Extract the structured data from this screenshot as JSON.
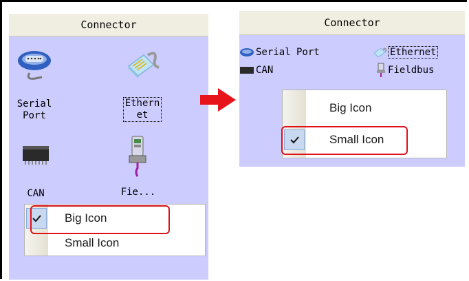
{
  "left_panel": {
    "header": "Connector",
    "items": [
      {
        "label_line1": "Serial",
        "label_line2": "Port",
        "icon": "serial-port-icon"
      },
      {
        "label_line1": "Ethern",
        "label_line2": "et",
        "icon": "ethernet-icon"
      },
      {
        "label_line1": "CAN",
        "icon": "can-icon"
      },
      {
        "label_line1": "Fie...",
        "icon": "fieldbus-icon"
      }
    ],
    "menu": {
      "item1": "Big Icon",
      "item2": "Small Icon",
      "checked": "item1"
    }
  },
  "right_panel": {
    "header": "Connector",
    "items": [
      {
        "label": "Serial Port",
        "icon": "serial-port-icon"
      },
      {
        "label": "Ethernet",
        "icon": "ethernet-icon"
      },
      {
        "label": "CAN",
        "icon": "can-icon"
      },
      {
        "label": "Fieldbus",
        "icon": "fieldbus-icon"
      }
    ],
    "menu": {
      "item1": "Big Icon",
      "item2": "Small Icon",
      "checked": "item2"
    }
  },
  "colors": {
    "panel_bg": "#ccccff",
    "header_bg": "#f0eee0",
    "highlight": "#e0101a",
    "arrow": "#e8141c"
  }
}
